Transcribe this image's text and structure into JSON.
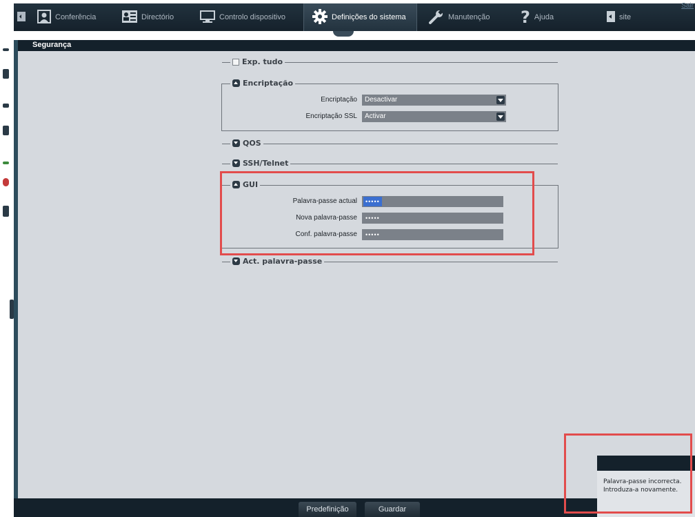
{
  "nav": {
    "items": [
      {
        "label": "",
        "icon": "back-icon"
      },
      {
        "label": "Conferência",
        "icon": "conference-icon"
      },
      {
        "label": "Directório",
        "icon": "directory-icon"
      },
      {
        "label": "Controlo dispositivo",
        "icon": "monitor-icon"
      },
      {
        "label": "Definições do sistema",
        "icon": "gear-icon",
        "active": true
      },
      {
        "label": "Manutenção",
        "icon": "wrench-icon"
      },
      {
        "label": "Ajuda",
        "icon": "help-icon"
      },
      {
        "label": "site",
        "icon": "site-icon"
      }
    ],
    "exit_label": "Sair"
  },
  "section": {
    "title": "Segurança"
  },
  "groups": {
    "expand_all": {
      "label": "Exp. tudo",
      "checked": false
    },
    "encryption": {
      "title": "Encriptação",
      "expanded": true,
      "fields": [
        {
          "label": "Encriptação",
          "value": "Desactivar"
        },
        {
          "label": "Encriptação SSL",
          "value": "Activar"
        }
      ]
    },
    "qos": {
      "title": "QOS",
      "expanded": false
    },
    "ssh": {
      "title": "SSH/Telnet",
      "expanded": false
    },
    "gui": {
      "title": "GUI",
      "expanded": true,
      "fields": [
        {
          "label": "Palavra-passe actual",
          "value": "•••••",
          "focused": true
        },
        {
          "label": "Nova palavra-passe",
          "value": "•••••"
        },
        {
          "label": "Conf. palavra-passe",
          "value": "•••••"
        }
      ]
    },
    "act_password": {
      "title": "Act. palavra-passe",
      "expanded": false
    }
  },
  "buttons": {
    "default_label": "Predefinição",
    "save_label": "Guardar"
  },
  "notification": {
    "line1": "Palavra-passe incorrecta.",
    "line2": "Introduza-a novamente."
  },
  "colors": {
    "highlight": "#e24c4c",
    "nav_bg": "#1a2731",
    "content_bg": "#d5d9de"
  }
}
